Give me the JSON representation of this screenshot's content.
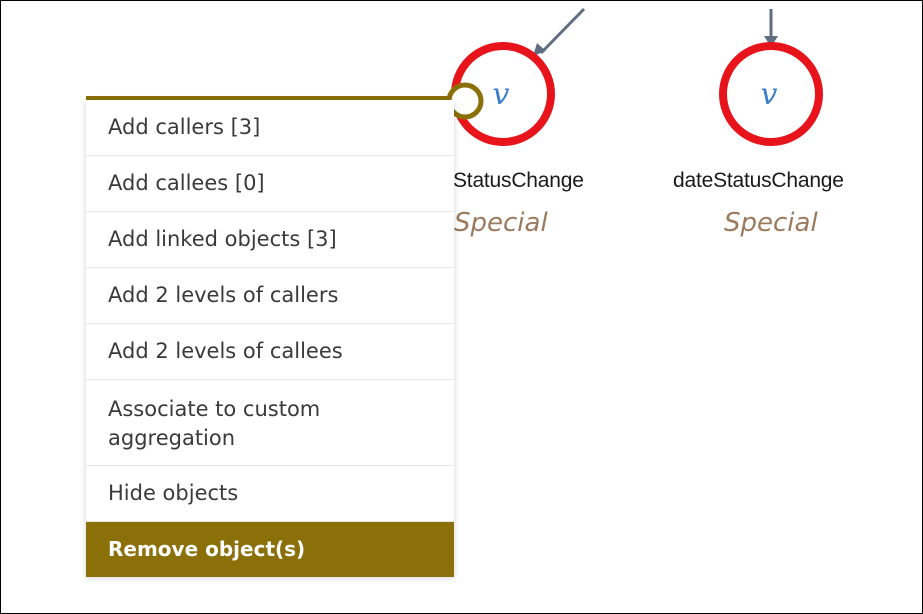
{
  "graph": {
    "nodes": [
      {
        "label": "StatusChange",
        "type_label": "Special",
        "icon_glyph": "v"
      },
      {
        "label": "dateStatusChange",
        "type_label": "Special",
        "icon_glyph": "v"
      }
    ],
    "colors": {
      "node_ring": "#e8141c",
      "icon_text": "#3b7fc8",
      "edge": "#5f6e80",
      "selection_accent": "#8b7009"
    }
  },
  "context_menu": {
    "items": [
      {
        "label": "Add callers [3]"
      },
      {
        "label": "Add callees [0]"
      },
      {
        "label": "Add linked objects [3]"
      },
      {
        "label": "Add 2 levels of callers"
      },
      {
        "label": "Add 2 levels of callees"
      },
      {
        "label": "Associate to custom aggregation"
      },
      {
        "label": "Hide objects"
      },
      {
        "label": "Remove object(s)",
        "state": "highlighted"
      }
    ]
  }
}
